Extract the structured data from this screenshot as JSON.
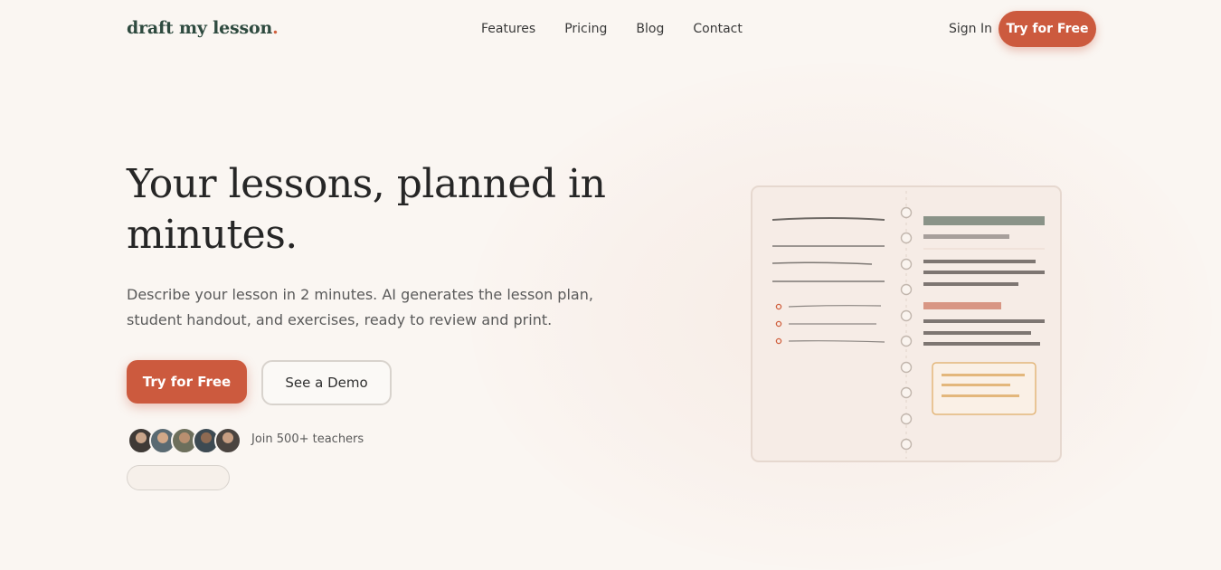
{
  "brand": {
    "name": "draft my lesson",
    "dot": ".",
    "accent": "#cc5a3e",
    "logo_color": "#2e4a3f"
  },
  "nav": {
    "links": [
      "Features",
      "Pricing",
      "Blog",
      "Contact"
    ],
    "sign_in": "Sign In",
    "cta": "Try for Free"
  },
  "hero": {
    "headline_part1": "Your lessons, planned in",
    "headline_part2": "minutes.",
    "description": "Describe your lesson in 2 minutes. AI generates the lesson plan, student handout, and exercises, ready to review and print.",
    "primary_cta": "Try for Free",
    "secondary_cta": "See a Demo",
    "social_proof": "Join 500+ teachers"
  },
  "illustration": {
    "icon": "notebook-illustration"
  }
}
